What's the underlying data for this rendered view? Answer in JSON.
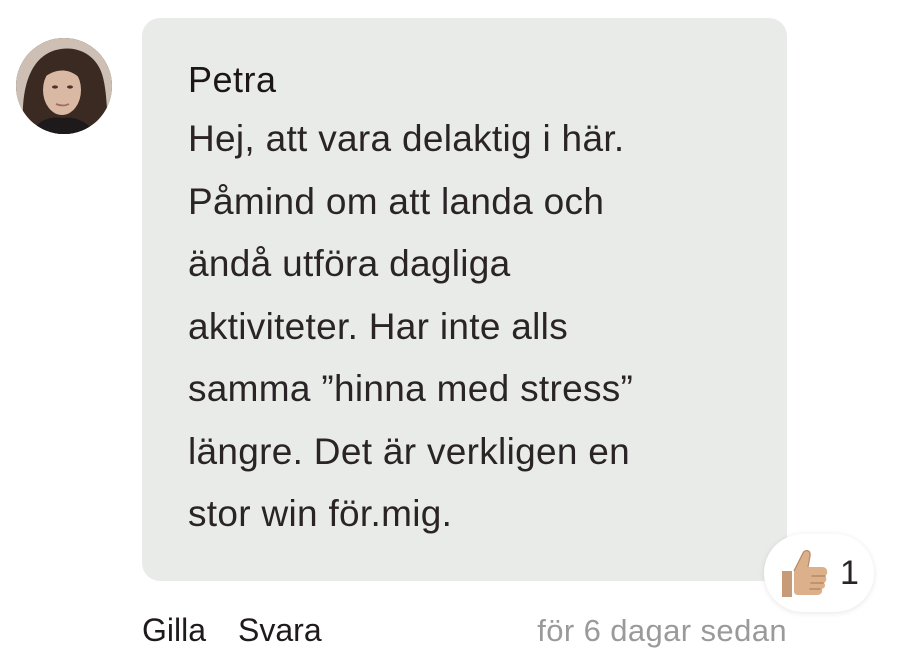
{
  "comment": {
    "author": "Petra",
    "text": "Hej, att vara delaktig i här.\nPåmind om att landa och\nändå utföra dagliga\naktiviteter. Har inte alls\nsamma ”hinna med stress”\nlängre. Det är verkligen en\nstor win för.mig.",
    "avatar_icon": "user-photo",
    "reaction": {
      "icon": "thumbs-up-icon",
      "count": "1"
    },
    "actions": {
      "like_label": "Gilla",
      "reply_label": "Svara"
    },
    "timestamp": "för 6 dagar sedan"
  }
}
